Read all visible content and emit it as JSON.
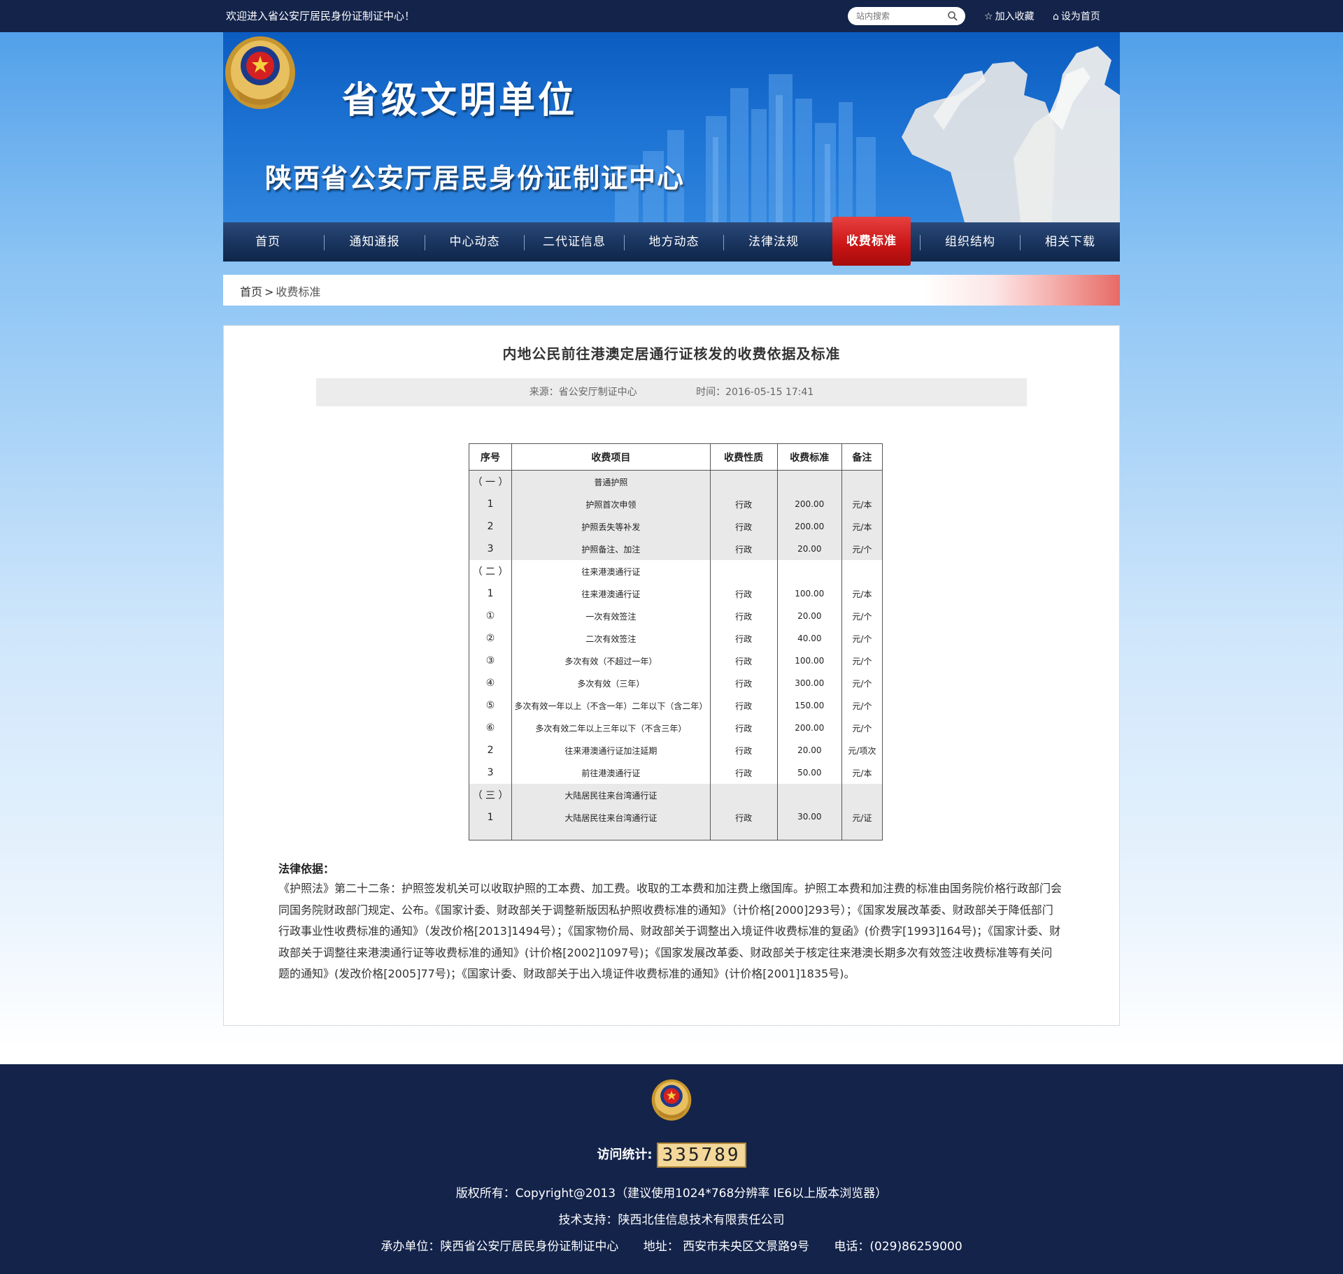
{
  "topbar": {
    "welcome": "欢迎进入省公安厅居民身份证制证中心！",
    "search_placeholder": "站内搜索",
    "favorite": "加入收藏",
    "homepage": "设为首页"
  },
  "banner": {
    "title1": "省级文明单位",
    "title2": "陕西省公安厅居民身份证制证中心"
  },
  "nav": {
    "items": [
      "首页",
      "通知通报",
      "中心动态",
      "二代证信息",
      "地方动态",
      "法律法规",
      "收费标准",
      "组织结构",
      "相关下载"
    ],
    "active_index": 6
  },
  "breadcrumb": {
    "home": "首页",
    "separator": ">",
    "current": "收费标准"
  },
  "article": {
    "title": "内地公民前往港澳定居通行证核发的收费依据及标准",
    "source": "来源：省公安厅制证中心",
    "time": "时间：2016-05-15 17:41"
  },
  "table": {
    "headers": [
      "序号",
      "收费项目",
      "收费性质",
      "收费标准",
      "备注"
    ],
    "rows": [
      {
        "no": "（ 一 ）",
        "item": "普通护照",
        "nature": "",
        "fee": "",
        "note": "",
        "shade": true
      },
      {
        "no": "1",
        "item": "护照首次申领",
        "nature": "行政",
        "fee": "200.00",
        "note": "元/本",
        "shade": true
      },
      {
        "no": "2",
        "item": "护照丢失等补发",
        "nature": "行政",
        "fee": "200.00",
        "note": "元/本",
        "shade": true
      },
      {
        "no": "3",
        "item": "护照备注、加注",
        "nature": "行政",
        "fee": "20.00",
        "note": "元/个",
        "shade": true
      },
      {
        "no": "（ 二 ）",
        "item": "往来港澳通行证",
        "nature": "",
        "fee": "",
        "note": "",
        "shade": false
      },
      {
        "no": "1",
        "item": "往来港澳通行证",
        "nature": "行政",
        "fee": "100.00",
        "note": "元/本",
        "shade": false
      },
      {
        "no": "①",
        "item": "一次有效签注",
        "nature": "行政",
        "fee": "20.00",
        "note": "元/个",
        "shade": false
      },
      {
        "no": "②",
        "item": "二次有效签注",
        "nature": "行政",
        "fee": "40.00",
        "note": "元/个",
        "shade": false
      },
      {
        "no": "③",
        "item": "多次有效（不超过一年）",
        "nature": "行政",
        "fee": "100.00",
        "note": "元/个",
        "shade": false
      },
      {
        "no": "④",
        "item": "多次有效（三年）",
        "nature": "行政",
        "fee": "300.00",
        "note": "元/个",
        "shade": false
      },
      {
        "no": "⑤",
        "item": "多次有效一年以上（不含一年）二年以下（含二年）",
        "nature": "行政",
        "fee": "150.00",
        "note": "元/个",
        "shade": false
      },
      {
        "no": "⑥",
        "item": "多次有效二年以上三年以下（不含三年）",
        "nature": "行政",
        "fee": "200.00",
        "note": "元/个",
        "shade": false
      },
      {
        "no": "2",
        "item": "往来港澳通行证加注延期",
        "nature": "行政",
        "fee": "20.00",
        "note": "元/项次",
        "shade": false
      },
      {
        "no": "3",
        "item": "前往港澳通行证",
        "nature": "行政",
        "fee": "50.00",
        "note": "元/本",
        "shade": false
      },
      {
        "no": "（ 三 ）",
        "item": "大陆居民往来台湾通行证",
        "nature": "",
        "fee": "",
        "note": "",
        "shade": true
      },
      {
        "no": "1",
        "item": "大陆居民往来台湾通行证",
        "nature": "行政",
        "fee": "30.00",
        "note": "元/证",
        "shade": true
      }
    ]
  },
  "law": {
    "heading": "法律依据：",
    "text": "《护照法》第二十二条：护照签发机关可以收取护照的工本费、加工费。收取的工本费和加注费上缴国库。护照工本费和加注费的标准由国务院价格行政部门会同国务院财政部门规定、公布。《国家计委、财政部关于调整新版因私护照收费标准的通知》（计价格[2000]293号）；《国家发展改革委、财政部关于降低部门行政事业性收费标准的通知》（发改价格[2013]1494号）；《国家物价局、财政部关于调整出入境证件收费标准的复函》(价费字[1993]164号)；《国家计委、财政部关于调整往来港澳通行证等收费标准的通知》(计价格[2002]1097号)；《国家发展改革委、财政部关于核定往来港澳长期多次有效签注收费标准等有关问题的通知》(发改价格[2005]77号)；《国家计委、财政部关于出入境证件收费标准的通知》(计价格[2001]1835号)。"
  },
  "footer": {
    "visit_label": "访问统计:",
    "visit_count": "335789",
    "copyright": "版权所有：Copyright@2013（建议使用1024*768分辨率  IE6以上版本浏览器）",
    "support": "技术支持：陕西北佳信息技术有限责任公司",
    "organizer": "承办单位：陕西省公安厅居民身份证制证中心",
    "address": "地址： 西安市未央区文景路9号",
    "phone": "电话：(029)86259000"
  },
  "colors": {
    "topbar_bg": "#13234a",
    "nav_active": "#c81414",
    "banner_blue": "#0b5cc0"
  }
}
